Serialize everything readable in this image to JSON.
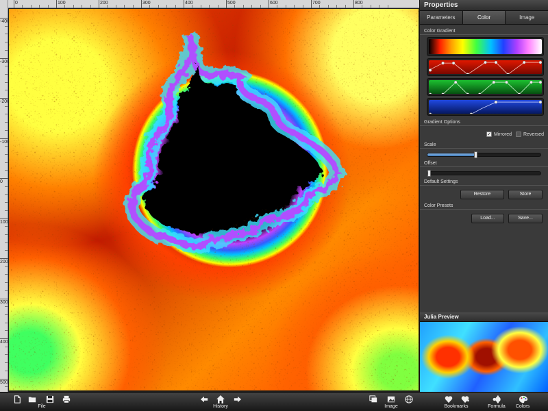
{
  "ruler": {
    "top_labels": [
      "0",
      "100",
      "200",
      "300",
      "400",
      "500",
      "600",
      "700",
      "800"
    ],
    "left_labels": [
      "-400",
      "-300",
      "-200",
      "-100",
      "0",
      "100",
      "200",
      "300",
      "400",
      "500"
    ]
  },
  "properties": {
    "title": "Properties",
    "tabs": [
      {
        "label": "Parameters",
        "active": false
      },
      {
        "label": "Color",
        "active": true
      },
      {
        "label": "Image",
        "active": false
      }
    ],
    "color_gradient_label": "Color Gradient",
    "gradient_options_label": "Gradient Options",
    "mirrored_label": "Mirrored",
    "mirrored_checked": true,
    "reversed_label": "Reversed",
    "reversed_checked": false,
    "scale_label": "Scale",
    "scale_value": 0.42,
    "offset_label": "Offset",
    "offset_value": 0.0,
    "default_settings_label": "Default Settings",
    "restore_label": "Restore",
    "store_label": "Store",
    "color_presets_label": "Color Presets",
    "load_label": "Load...",
    "save_label": "Save..."
  },
  "julia": {
    "title": "Julia Preview"
  },
  "toolbar": {
    "file_label": "File",
    "history_label": "History",
    "image_label": "Image",
    "bookmarks_label": "Bookmarks",
    "formula_label": "Formula",
    "colors_label": "Colors"
  },
  "colors": {
    "panel_bg": "#3a3a3a",
    "accent_slider": "#3d79b8",
    "red_channel": "#c01000",
    "green_channel": "#10a020",
    "blue_channel": "#1030c0"
  }
}
